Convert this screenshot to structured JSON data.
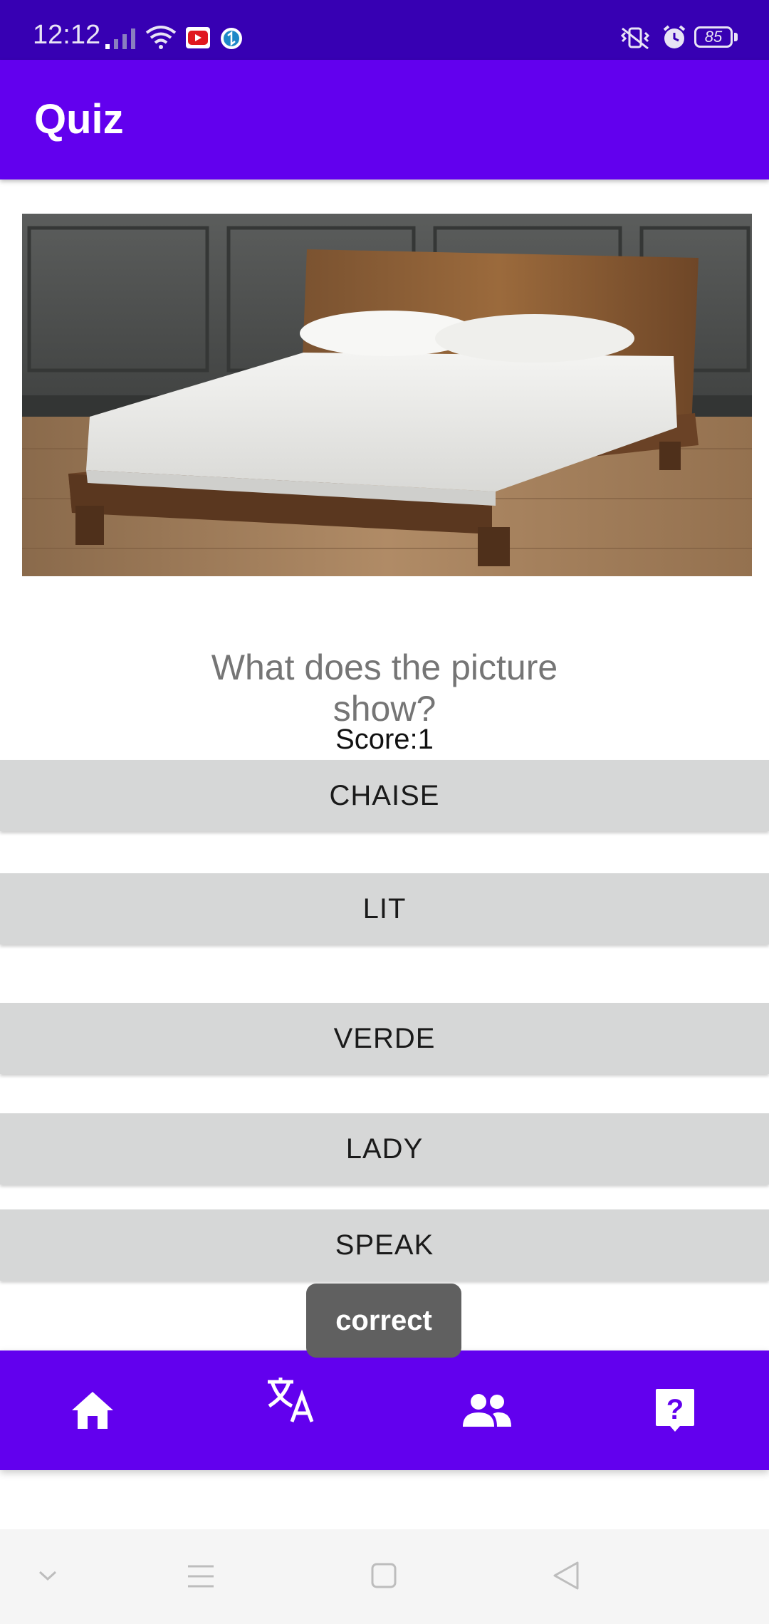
{
  "status_bar": {
    "time": "12:12",
    "battery": "85",
    "icons": [
      "signal-icon",
      "wifi-icon",
      "youtube-icon",
      "sync-app-icon",
      "vibrate-icon",
      "alarm-icon",
      "battery-icon"
    ]
  },
  "app_bar": {
    "title": "Quiz"
  },
  "quiz": {
    "image_subject": "bed",
    "question": "What does the picture show?",
    "score": "Score:1",
    "answers": [
      "CHAISE",
      "LIT",
      "VERDE",
      "LADY",
      "SPEAK"
    ]
  },
  "toast": {
    "message": "correct"
  },
  "bottom_nav": {
    "items": [
      "home-icon",
      "translate-icon",
      "people-icon",
      "quiz-icon"
    ]
  },
  "system_nav": [
    "chevron-down-icon",
    "menu-icon",
    "home-square-icon",
    "back-icon"
  ],
  "colors": {
    "primary": "#6200ee",
    "status_bar": "#3700b3",
    "button": "#d6d7d7",
    "toast": "#606060"
  }
}
